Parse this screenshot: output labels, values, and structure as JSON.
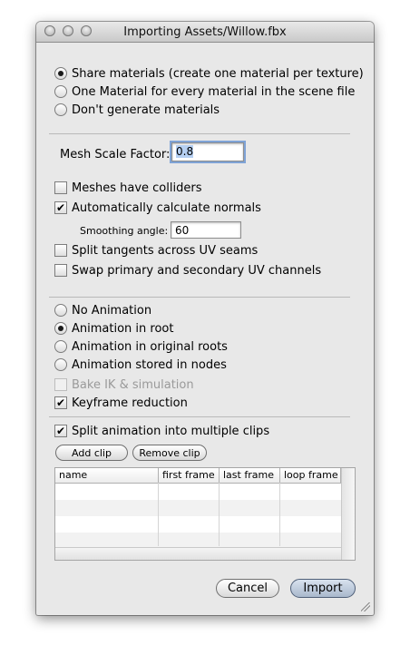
{
  "window": {
    "title": "Importing Assets/Willow.fbx"
  },
  "materials": {
    "options": [
      {
        "label": "Share materials (create one material per texture)",
        "selected": true
      },
      {
        "label": "One Material for every material in the scene file",
        "selected": false
      },
      {
        "label": "Don't generate materials",
        "selected": false
      }
    ]
  },
  "mesh": {
    "scale_label": "Mesh Scale Factor:",
    "scale_value": "0.8",
    "colliders_label": "Meshes have colliders",
    "colliders_checked": false,
    "normals_label": "Automatically calculate normals",
    "normals_checked": true,
    "smoothing_label": "Smoothing angle:",
    "smoothing_value": "60",
    "split_tangents_label": "Split tangents across UV seams",
    "split_tangents_checked": false,
    "swap_uv_label": "Swap primary and secondary UV channels",
    "swap_uv_checked": false
  },
  "animation": {
    "options": [
      {
        "label": "No Animation",
        "selected": false
      },
      {
        "label": "Animation in root",
        "selected": true
      },
      {
        "label": "Animation in original roots",
        "selected": false
      },
      {
        "label": "Animation stored in nodes",
        "selected": false
      }
    ],
    "bake_label": "Bake IK & simulation",
    "bake_checked": false,
    "keyframe_label": "Keyframe reduction",
    "keyframe_checked": true,
    "split_clips_label": "Split animation into multiple clips",
    "split_clips_checked": true,
    "add_clip_label": "Add clip",
    "remove_clip_label": "Remove clip"
  },
  "clips_table": {
    "columns": [
      "name",
      "first frame",
      "last frame",
      "loop frame"
    ],
    "rows": []
  },
  "buttons": {
    "cancel": "Cancel",
    "import": "Import"
  }
}
